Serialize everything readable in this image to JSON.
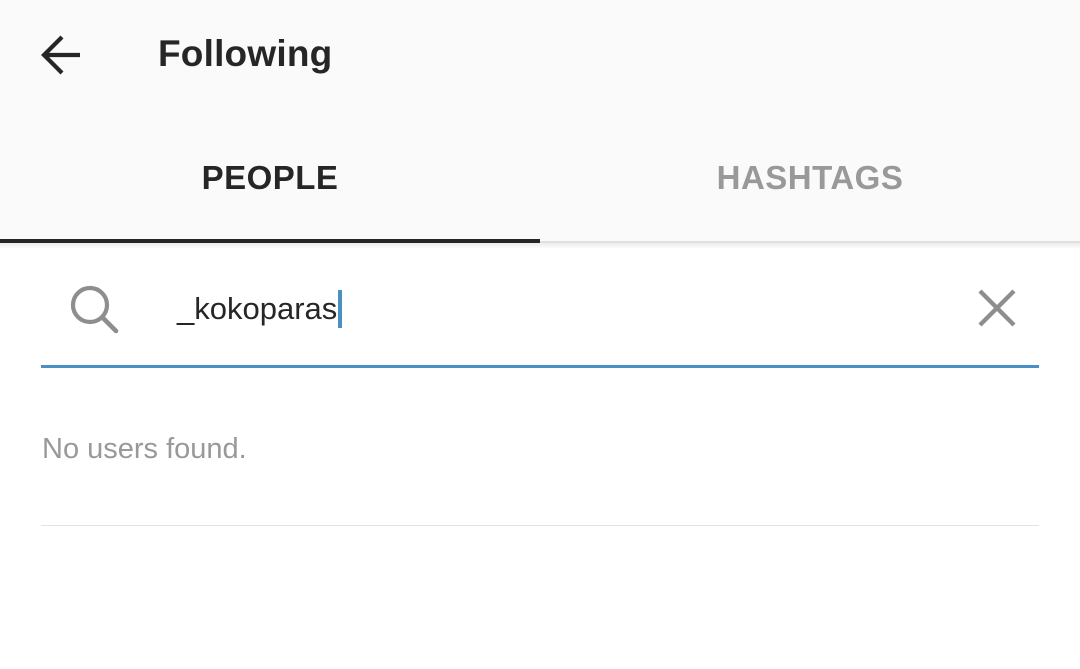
{
  "header": {
    "title": "Following",
    "back_icon": "arrow-left-icon"
  },
  "tabs": [
    {
      "label": "PEOPLE",
      "active": true
    },
    {
      "label": "HASHTAGS",
      "active": false
    }
  ],
  "search": {
    "value": "_kokoparas",
    "search_icon": "search-icon",
    "clear_icon": "close-icon"
  },
  "results": {
    "empty_message": "No users found."
  },
  "colors": {
    "accent": "#4a90c2",
    "text_primary": "#262626",
    "text_secondary": "#999999",
    "header_bg": "#fafafa"
  }
}
